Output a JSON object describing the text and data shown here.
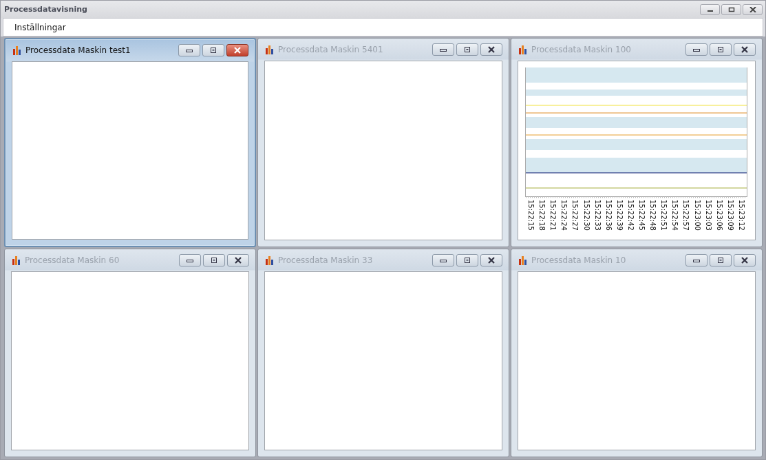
{
  "window": {
    "title": "Processdatavisning"
  },
  "menu": [
    "Inställningar"
  ],
  "child_windows": [
    {
      "title": "Processdata Maskin test1",
      "active": true
    },
    {
      "title": "Processdata Maskin 5401",
      "active": false
    },
    {
      "title": "Processdata Maskin 100",
      "active": false,
      "chart": {
        "time_labels": [
          "15:22:15",
          "15:22:18",
          "15:22:21",
          "15:22:24",
          "15:22:27",
          "15:22:30",
          "15:22:33",
          "15:22:36",
          "15:22:39",
          "15:22:42",
          "15:22:45",
          "15:22:48",
          "15:22:51",
          "15:22:54",
          "15:22:57",
          "15:23:00",
          "15:23:03",
          "15:23:06",
          "15:23:09",
          "15:23:12"
        ]
      }
    },
    {
      "title": "Processdata Maskin 60",
      "active": false
    },
    {
      "title": "Processdata Maskin 33",
      "active": false
    },
    {
      "title": "Processdata Maskin 10",
      "active": false
    }
  ]
}
